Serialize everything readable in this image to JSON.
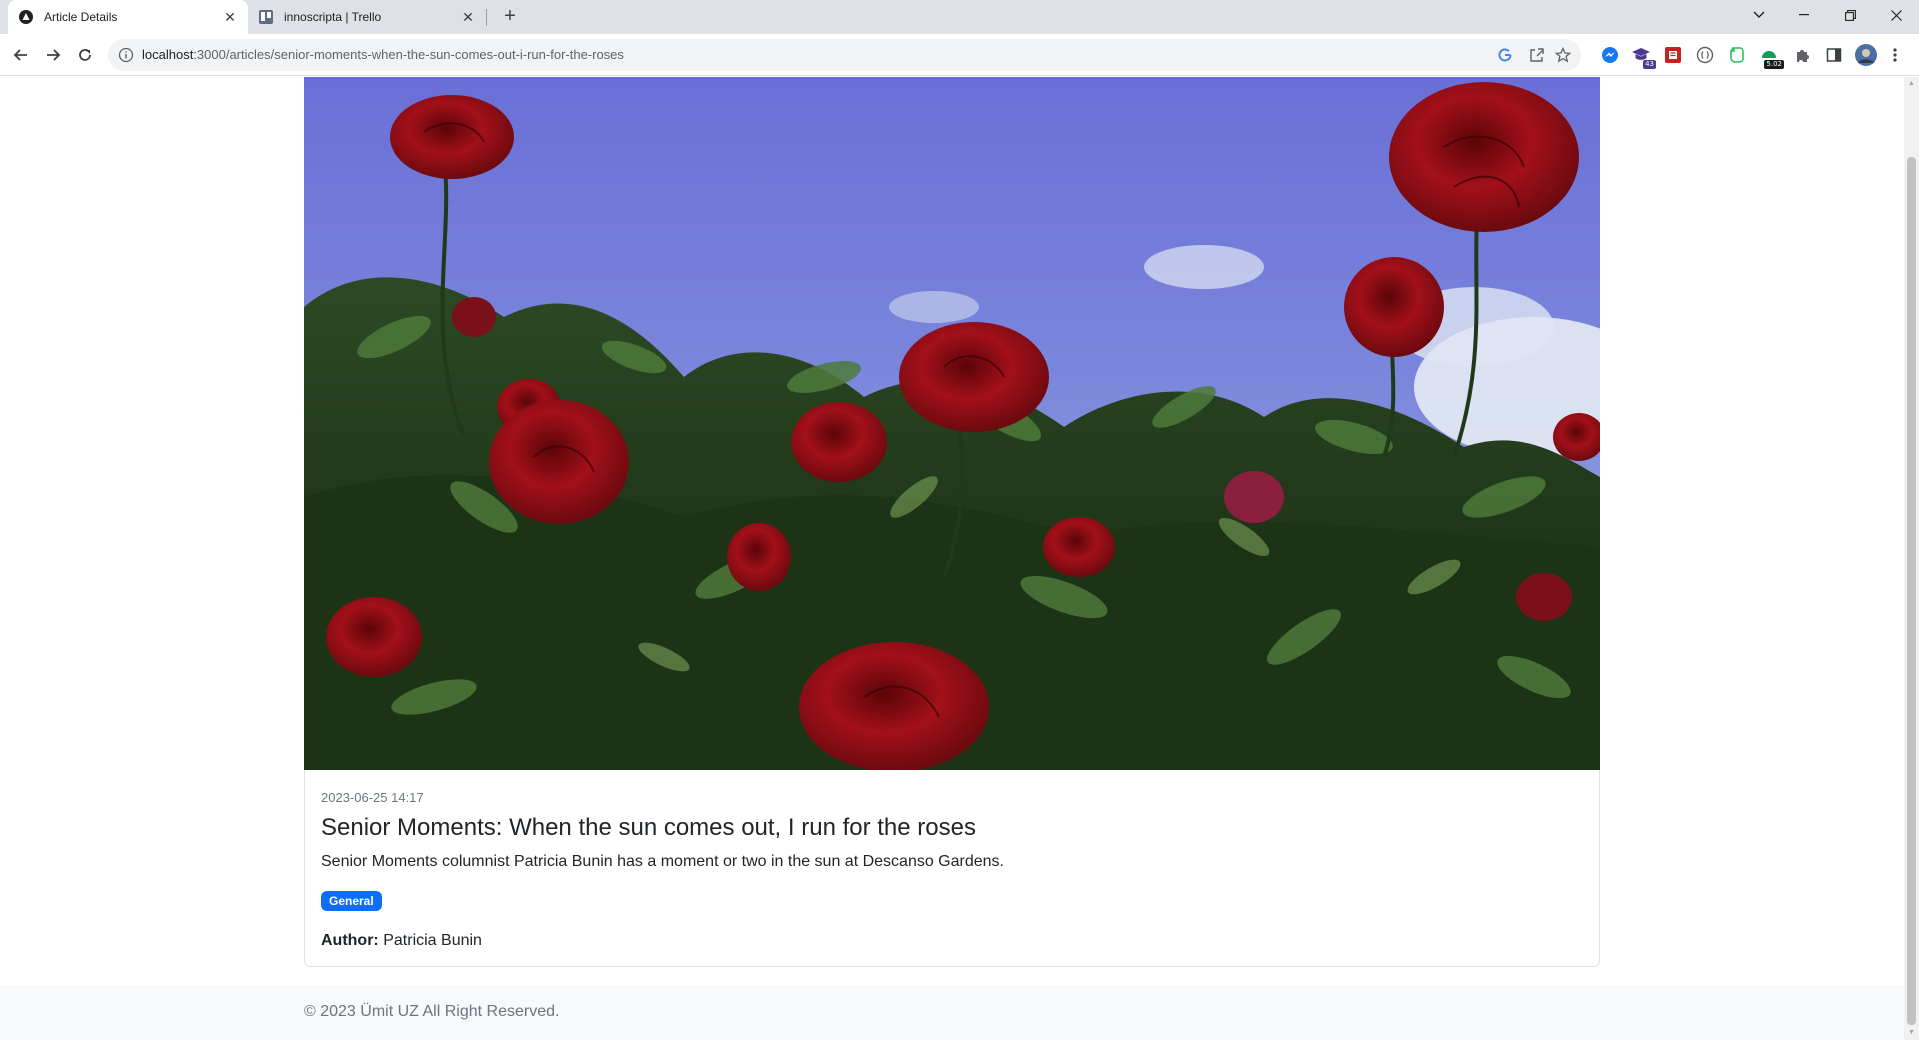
{
  "browser": {
    "tabs": [
      {
        "title": "Article Details",
        "icon": "react-app-icon",
        "active": true
      },
      {
        "title": "innoscripta | Trello",
        "icon": "trello-icon",
        "active": false
      }
    ],
    "url": {
      "host": "localhost",
      "rest": ":3000/articles/senior-moments-when-the-sun-comes-out-i-run-for-the-roses"
    },
    "extensions": [
      {
        "name": "messenger-ext-icon",
        "badge": ""
      },
      {
        "name": "grad-cap-ext-icon",
        "badge": "43"
      },
      {
        "name": "red-ext-icon",
        "badge": ""
      },
      {
        "name": "circle-ext-icon",
        "badge": ""
      },
      {
        "name": "evernote-ext-icon",
        "badge": ""
      },
      {
        "name": "green-ext-icon",
        "badge": "5.02"
      }
    ]
  },
  "article": {
    "image_alt": "Red roses against a blue sky",
    "date": "2023-06-25 14:17",
    "title": "Senior Moments: When the sun comes out, I run for the roses",
    "description": "Senior Moments columnist Patricia Bunin has a moment or two in the sun at Descanso Gardens.",
    "category": "General",
    "author_label": "Author:",
    "author_name": "Patricia Bunin"
  },
  "footer": {
    "text": "© 2023 Ümit UZ All Right Reserved."
  },
  "colors": {
    "badge": "#0d6efd",
    "footer_bg": "#f8f9fa",
    "tabstrip": "#dee1e6"
  }
}
